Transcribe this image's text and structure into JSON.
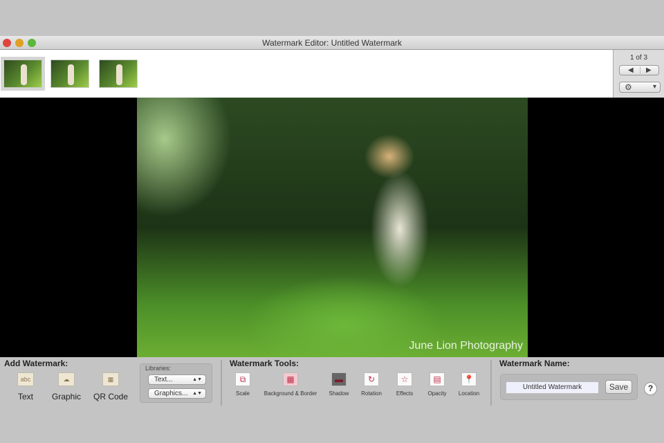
{
  "window": {
    "title": "Watermark Editor: Untitled Watermark"
  },
  "pager": {
    "count": "1 of 3",
    "prev": "◀",
    "next": "▶",
    "settings": "⚙",
    "menu": "▾"
  },
  "photo": {
    "watermark_text": "June Lion Photography"
  },
  "add_watermark": {
    "heading": "Add Watermark:",
    "items": [
      {
        "label": "Text",
        "icon": "abc"
      },
      {
        "label": "Graphic",
        "icon": "☁"
      },
      {
        "label": "QR Code",
        "icon": "▦"
      }
    ]
  },
  "libraries": {
    "label": "Libraries:",
    "text_select": "Text...",
    "graphics_select": "Graphics..."
  },
  "tools": {
    "heading": "Watermark Tools:",
    "items": [
      {
        "label": "Scale",
        "icon": "⧉"
      },
      {
        "label": "Background & Border",
        "icon": "▦"
      },
      {
        "label": "Shadow",
        "icon": "▬"
      },
      {
        "label": "Rotation",
        "icon": "↻"
      },
      {
        "label": "Effects",
        "icon": "☆"
      },
      {
        "label": "Opacity",
        "icon": "▤"
      },
      {
        "label": "Location",
        "icon": "📍"
      }
    ]
  },
  "name": {
    "heading": "Watermark Name:",
    "value": "Untitled Watermark",
    "save": "Save",
    "help": "?"
  }
}
